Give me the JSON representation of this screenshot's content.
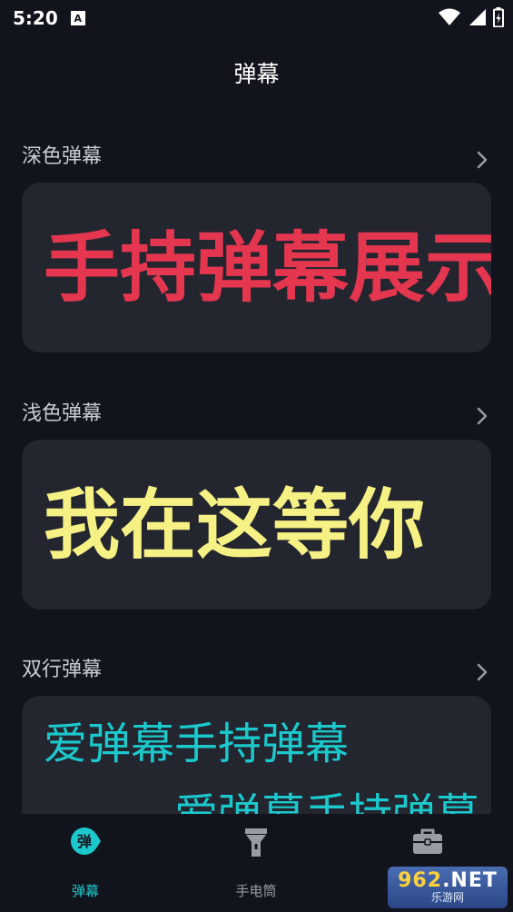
{
  "status_bar": {
    "time": "5:20",
    "notification_glyph": "A"
  },
  "page": {
    "title": "弹幕"
  },
  "sections": [
    {
      "label": "深色弹幕",
      "preview_text": "手持弹幕展示",
      "text_color": "#e5364f"
    },
    {
      "label": "浅色弹幕",
      "preview_text": "我在这等你",
      "text_color": "#f6f184"
    },
    {
      "label": "双行弹幕",
      "preview_line1": "爱弹幕手持弹幕",
      "preview_line2": "爱弹幕手持弹幕",
      "text_color": "#1bc9cc"
    }
  ],
  "nav": {
    "items": [
      {
        "label": "弹幕",
        "icon": "danmu-icon",
        "active": true
      },
      {
        "label": "手电筒",
        "icon": "flashlight-icon",
        "active": false
      },
      {
        "label": "",
        "icon": "toolbox-icon",
        "active": false
      }
    ]
  },
  "watermark": {
    "top": "962.NET",
    "bottom": "乐游网"
  },
  "colors": {
    "background": "#12141d",
    "card": "#23252f",
    "accent": "#1bc9cc",
    "inactive": "#9a9ca4"
  }
}
